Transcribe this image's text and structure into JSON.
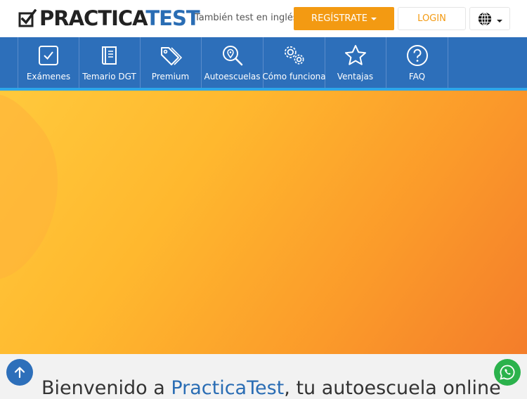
{
  "header": {
    "logo": {
      "part1": "PRACTICA",
      "part2": "TEST",
      "icon": "checkbox-check-icon"
    },
    "alt_language_link": "También test en inglés",
    "register_label": "REGÍSTRATE",
    "login_label": "LOGIN",
    "language_icon": "globe-icon"
  },
  "nav": {
    "items": [
      {
        "label": "Exámenes",
        "icon": "check-square-icon"
      },
      {
        "label": "Temario DGT",
        "icon": "book-icon"
      },
      {
        "label": "Premium",
        "icon": "tags-icon"
      },
      {
        "label": "Autoescuelas",
        "icon": "map-search-icon"
      },
      {
        "label": "Cómo funciona",
        "icon": "gears-icon"
      },
      {
        "label": "Ventajas",
        "icon": "star-icon"
      },
      {
        "label": "FAQ",
        "icon": "question-circle-icon"
      }
    ]
  },
  "hero": {
    "welcome_prefix": "Bienvenido a ",
    "welcome_brand": "PracticaTest",
    "welcome_suffix": ", tu autoescuela online"
  },
  "floating": {
    "scroll_top_icon": "arrow-up-icon",
    "chat_icon": "whatsapp-icon"
  },
  "colors": {
    "brand_blue": "#2d6fba",
    "accent_orange": "#f39a12",
    "whatsapp_green": "#2bb24c",
    "accent_line": "#2ea6e8"
  }
}
